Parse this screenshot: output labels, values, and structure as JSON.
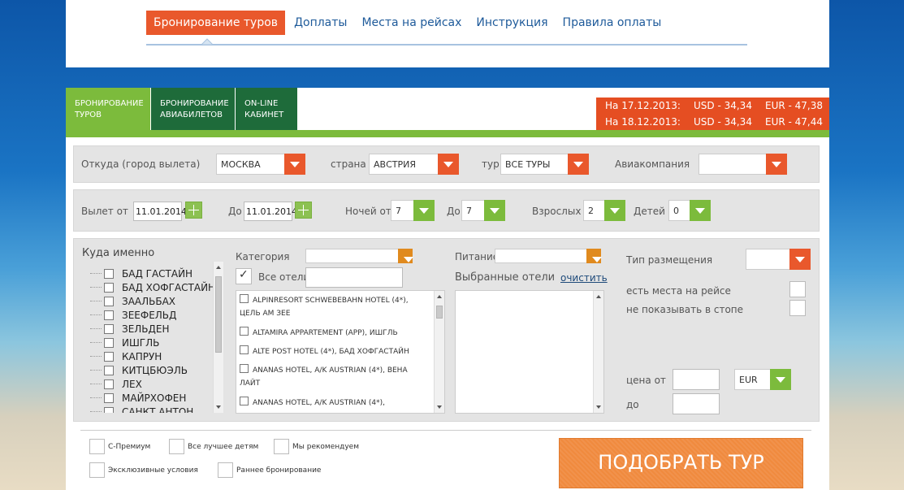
{
  "top_nav": {
    "items": [
      {
        "label": "Бронирование туров",
        "active": true
      },
      {
        "label": "Доплаты"
      },
      {
        "label": "Места на рейсах"
      },
      {
        "label": "Инструкция"
      },
      {
        "label": "Правила оплаты"
      }
    ]
  },
  "tabs": [
    {
      "line1": "БРОНИРОВАНИЕ",
      "line2": "ТУРОВ"
    },
    {
      "line1": "БРОНИРОВАНИЕ",
      "line2": "АВИАБИЛЕТОВ"
    },
    {
      "line1": "ON-LINE",
      "line2": "КАБИНЕТ"
    }
  ],
  "rates": [
    {
      "date": "На 17.12.2013:",
      "usd": "USD - 34,34",
      "eur": "EUR - 47,38"
    },
    {
      "date": "На 18.12.2013:",
      "usd": "USD - 34,34",
      "eur": "EUR - 47,44"
    }
  ],
  "row1": {
    "from_label": "Откуда (город вылета)",
    "from_value": "МОСКВА",
    "country_label": "страна",
    "country_value": "АВСТРИЯ",
    "tour_label": "тур",
    "tour_value": "ВСЕ ТУРЫ",
    "airline_label": "Авиакомпания",
    "airline_value": ""
  },
  "row2": {
    "depart_from_label": "Вылет от",
    "depart_from_value": "11.01.2014",
    "depart_to_label": "До",
    "depart_to_value": "11.01.2014",
    "nights_label": "Ночей от",
    "nights_from": "7",
    "nights_to_label": "До",
    "nights_to": "7",
    "adults_label": "Взрослых",
    "adults_value": "2",
    "children_label": "Детей",
    "children_value": "0"
  },
  "destinations": {
    "label": "Куда именно",
    "cities": [
      "БАД ГАСТАЙН",
      "БАД ХОФГАСТАЙН",
      "ЗААЛЬБАХ",
      "ЗЕЕФЕЛЬД",
      "ЗЕЛЬДЕН",
      "ИШГЛЬ",
      "КАПРУН",
      "КИТЦБЮЭЛЬ",
      "ЛЕХ",
      "МАЙРХОФЕН",
      "САНКТ АНТОН"
    ]
  },
  "category": {
    "label": "Категория",
    "value": "",
    "all_hotels_label": "Все отели",
    "search_value": ""
  },
  "hotels": [
    {
      "line1": "ALPINRESORT SCHWEBEBAHN HOTEL (4*),",
      "line2": "ЦЕЛЬ АМ ЗЕЕ"
    },
    {
      "line1": "ALTAMIRA APPARTEMENT (APP), ИШГЛЬ",
      "line2": ""
    },
    {
      "line1": "ALTE POST HOTEL (4*), БАД ХОФГАСТАЙН",
      "line2": ""
    },
    {
      "line1": "ANANAS HOTEL, A/K AUSTRIAN (4*), ВЕНА",
      "line2": "ЛАЙТ"
    },
    {
      "line1": "ANANAS HOTEL, A/K AUSTRIAN (4*),",
      "line2": ""
    }
  ],
  "meals": {
    "label": "Питание",
    "value": "",
    "selected_hotels_label": "Выбранные отели",
    "clear_link": "очистить"
  },
  "right_panel": {
    "room_type_label": "Тип размещения",
    "room_type_value": "",
    "seats_label": "есть места на рейсе",
    "stop_label": "не показывать в стопе",
    "price_from_label": "цена от",
    "price_from_value": "",
    "price_to_label": "до",
    "price_to_value": "",
    "currency_value": "EUR"
  },
  "options": [
    {
      "label": "С-Премиум"
    },
    {
      "label": "Все лучшее детям"
    },
    {
      "label": "Мы рекомендуем"
    },
    {
      "label": "Эксклюзивные условия"
    },
    {
      "label": "Раннее бронирование"
    }
  ],
  "submit_label": "ПОДОБРАТЬ ТУР",
  "colors": {
    "accent_orange": "#e9582c",
    "accent_green": "#7cbb3c",
    "dark_green": "#1e6b3a",
    "link_blue": "#1e5a9a"
  }
}
